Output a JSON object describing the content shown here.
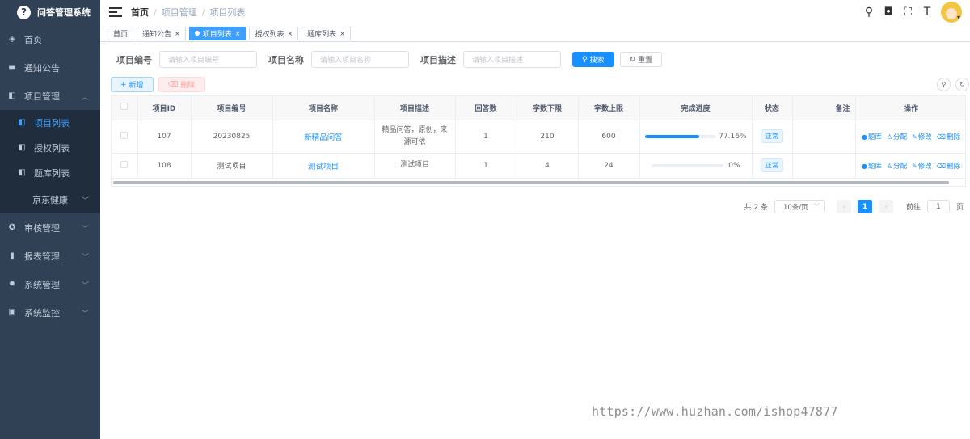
{
  "app": {
    "title": "问答管理系统",
    "logo_glyph": "?"
  },
  "sidebar": {
    "items": [
      {
        "label": "首页",
        "icon": "dashboard-icon"
      },
      {
        "label": "通知公告",
        "icon": "message-icon"
      },
      {
        "label": "项目管理",
        "icon": "book-icon",
        "expanded": true,
        "children": [
          {
            "label": "项目列表",
            "active": true
          },
          {
            "label": "授权列表"
          },
          {
            "label": "题库列表"
          },
          {
            "label": "京东健康",
            "has_children": true
          }
        ]
      },
      {
        "label": "审核管理",
        "icon": "gear-circle-icon"
      },
      {
        "label": "报表管理",
        "icon": "bar-chart-icon"
      },
      {
        "label": "系统管理",
        "icon": "settings-icon"
      },
      {
        "label": "系统监控",
        "icon": "monitor-icon"
      }
    ]
  },
  "breadcrumb": [
    "首页",
    "项目管理",
    "项目列表"
  ],
  "tags": [
    {
      "label": "首页",
      "closable": false,
      "active": false
    },
    {
      "label": "通知公告",
      "closable": true,
      "active": false
    },
    {
      "label": "项目列表",
      "closable": true,
      "active": true
    },
    {
      "label": "授权列表",
      "closable": true,
      "active": false
    },
    {
      "label": "题库列表",
      "closable": true,
      "active": false
    }
  ],
  "search": {
    "code_label": "项目编号",
    "code_placeholder": "请输入项目编号",
    "name_label": "项目名称",
    "name_placeholder": "请输入项目名称",
    "desc_label": "项目描述",
    "desc_placeholder": "请输入项目描述",
    "search_btn": "搜索",
    "reset_btn": "重置"
  },
  "toolbar": {
    "add_btn": "新增",
    "delete_btn": "删除"
  },
  "table": {
    "headers": [
      "项目ID",
      "项目编号",
      "项目名称",
      "项目描述",
      "回答数",
      "字数下限",
      "字数上限",
      "完成进度",
      "状态",
      "备注",
      "操作"
    ],
    "rows": [
      {
        "id": "107",
        "code": "20230825",
        "name": "新精品问答",
        "desc": "精品问答，原创，来源可依",
        "answers": "1",
        "min_words": "210",
        "max_words": "600",
        "progress": 77.16,
        "progress_label": "77.16%",
        "status": "正常",
        "remark": ""
      },
      {
        "id": "108",
        "code": "测试项目",
        "name": "测试项目",
        "desc": "测试项目",
        "answers": "1",
        "min_words": "4",
        "max_words": "24",
        "progress": 0,
        "progress_label": "0%",
        "status": "正常",
        "remark": ""
      }
    ],
    "ops": [
      "题库",
      "分配",
      "修改",
      "删除"
    ]
  },
  "pagination": {
    "total": "共 2 条",
    "page_size": "10条/页",
    "current": "1",
    "goto_label": "前往",
    "goto_value": "1",
    "page_unit": "页"
  },
  "watermark": "https://www.huzhan.com/ishop47877",
  "colors": {
    "sidebar_bg": "#304156",
    "primary": "#1890ff"
  }
}
